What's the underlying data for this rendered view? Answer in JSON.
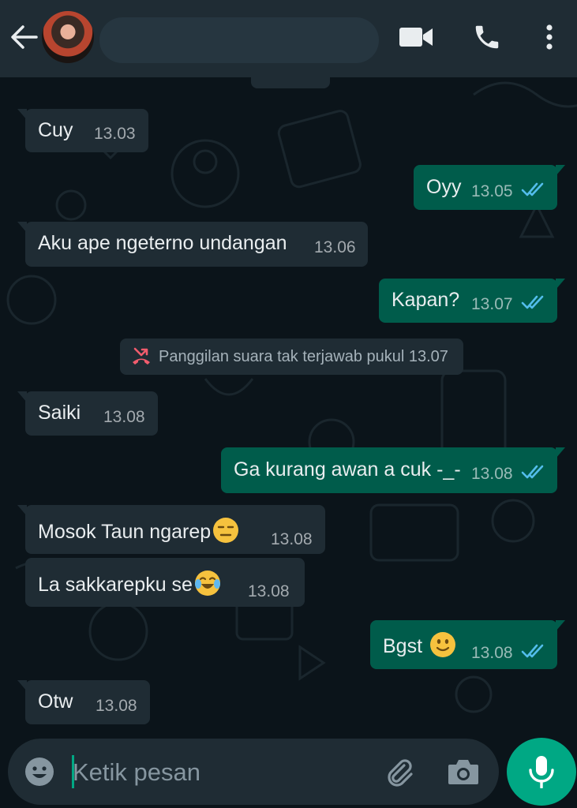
{
  "header": {
    "contact_name": ""
  },
  "messages": [
    {
      "dir": "in",
      "text": "Cuy",
      "time": "13.03"
    },
    {
      "dir": "out",
      "text": "Oyy",
      "time": "13.05",
      "status": "read"
    },
    {
      "dir": "in",
      "text": "Aku ape ngeterno undangan",
      "time": "13.06"
    },
    {
      "dir": "out",
      "text": "Kapan?",
      "time": "13.07",
      "status": "read"
    },
    {
      "dir": "in",
      "text": "Saiki",
      "time": "13.08"
    },
    {
      "dir": "out",
      "text": "Ga kurang awan a cuk -_-",
      "time": "13.08",
      "status": "read"
    },
    {
      "dir": "in",
      "text": "Mosok Taun ngarep",
      "emoji": "expressionless-face",
      "time": "13.08"
    },
    {
      "dir": "in",
      "text": "La sakkarepku se",
      "emoji": "tears-of-joy-face",
      "time": "13.08"
    },
    {
      "dir": "out",
      "text": "Bgst ",
      "emoji": "slightly-smiling-face",
      "time": "13.08",
      "status": "read"
    },
    {
      "dir": "in",
      "text": "Otw",
      "time": "13.08"
    }
  ],
  "system_note": {
    "text": "Panggilan suara tak terjawab pukul 13.07",
    "icon": "missed-call-icon"
  },
  "input": {
    "placeholder": "Ketik pesan"
  },
  "colors": {
    "background": "#0b141a",
    "header": "#1f2c34",
    "incoming_bubble": "#1f2c34",
    "outgoing_bubble": "#005c4b",
    "accent": "#00a884",
    "read_ticks": "#53bdeb",
    "missed_call": "#f15c6d"
  }
}
